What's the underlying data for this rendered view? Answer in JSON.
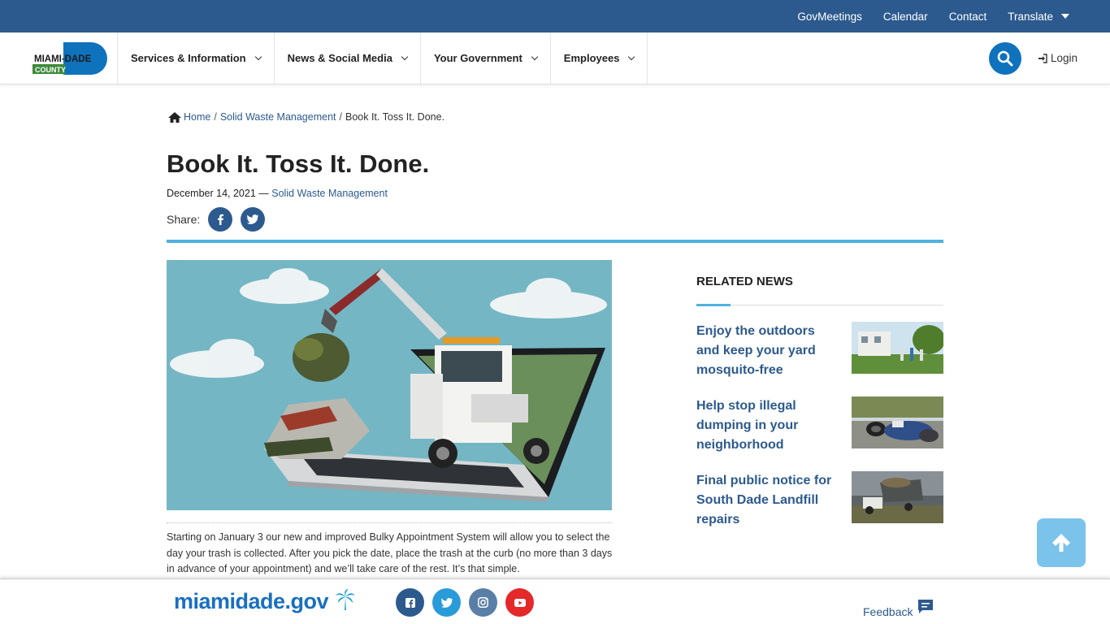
{
  "utility_nav": {
    "items": [
      "GovMeetings",
      "Calendar",
      "Contact",
      "Translate"
    ]
  },
  "logo": {
    "line1": "MIAMI-DADE",
    "line2": "COUNTY"
  },
  "main_nav": {
    "items": [
      "Services & Information",
      "News & Social Media",
      "Your Government",
      "Employees"
    ],
    "login": "Login"
  },
  "breadcrumb": {
    "home": "Home",
    "section": "Solid Waste Management",
    "current": "Book It. Toss It. Done."
  },
  "article": {
    "title": "Book It. Toss It. Done.",
    "date": "December 14, 2021",
    "separator": "—",
    "department": "Solid Waste Management",
    "share_label": "Share:",
    "body": "Starting on January 3 our new and improved Bulky Appointment System will allow you to select the day your trash is collected. After you pick the date, place the trash at the curb (no more than 3 days in advance of your appointment) and we’ll take care of the rest. It’s that simple."
  },
  "related": {
    "heading": "RELATED NEWS",
    "items": [
      {
        "title": "Enjoy the outdoors and keep your yard mosquito-free"
      },
      {
        "title": "Help stop illegal dumping in your neighborhood"
      },
      {
        "title": "Final public notice for South Dade Landfill repairs"
      }
    ]
  },
  "footer": {
    "brand": "miamidade.gov",
    "feedback": "Feedback",
    "social": [
      "facebook-icon",
      "twitter-icon",
      "instagram-icon",
      "youtube-icon"
    ]
  },
  "colors": {
    "utility_bar": "#2c5a8e",
    "link": "#2c5a8e",
    "accent_rule": "#4db3e0",
    "search_button": "#0f72bd",
    "back_to_top": "#7cc3ec"
  }
}
